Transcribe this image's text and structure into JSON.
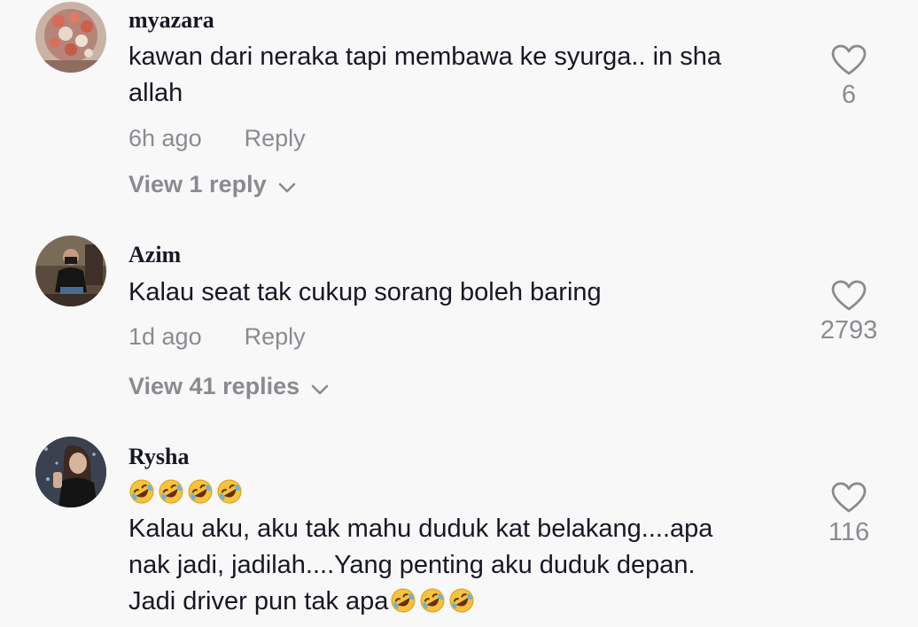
{
  "comments": [
    {
      "username": "myazara",
      "lines": [
        "kawan dari neraka tapi membawa ke syurga.. in sha",
        "allah"
      ],
      "time": "6h ago",
      "reply_label": "Reply",
      "view_replies": "View 1 reply",
      "likes": "6",
      "avatar": "flower-bouquet-avatar"
    },
    {
      "username": "Azim",
      "lines": [
        "Kalau seat tak cukup sorang boleh baring"
      ],
      "time": "1d ago",
      "reply_label": "Reply",
      "view_replies": "View 41 replies",
      "likes": "2793",
      "avatar": "masked-man-seated-avatar"
    },
    {
      "username": "Rysha",
      "emoji_line": "rolling-on-floor-laughing x4",
      "lines": [
        "Kalau aku, aku tak mahu duduk kat belakang....apa",
        "nak jadi, jadilah....Yang penting aku duduk depan.",
        "Jadi driver pun tak apa"
      ],
      "trailing_emoji": "rolling-on-floor-laughing x3",
      "likes": "116",
      "avatar": "woman-portrait-avatar"
    }
  ],
  "colors": {
    "background": "#f8f8f8",
    "text": "#161823",
    "muted": "#8a8b91"
  },
  "icons": {
    "like": "heart-outline-icon",
    "expand": "chevron-down-icon",
    "emoji": "rolling-on-floor-laughing-emoji"
  }
}
